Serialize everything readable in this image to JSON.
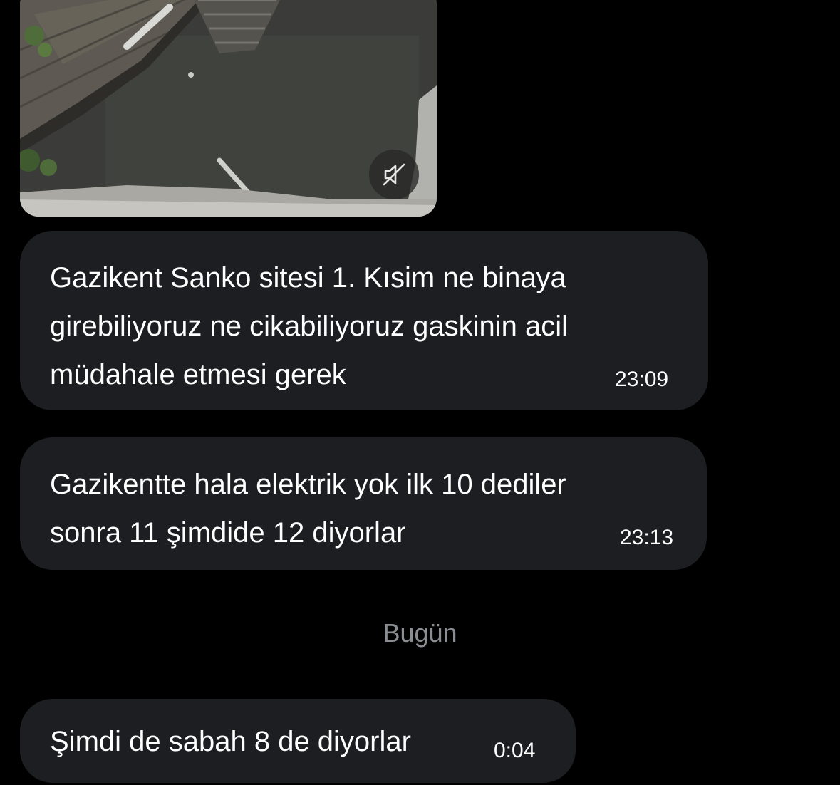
{
  "conversation": {
    "video_message": {
      "mute_icon": "speaker-muted-icon"
    },
    "messages": [
      {
        "lines": [
          "Gazikent Sanko sitesi 1. Kısim ne binaya",
          "girebiliyoruz ne cikabiliyoruz gaskinin acil",
          "müdahale etmesi gerek"
        ],
        "time": "23:09"
      },
      {
        "lines": [
          "Gazikentte hala elektrik yok ilk 10 dediler",
          "sonra 11 şimdide 12 diyorlar"
        ],
        "time": "23:13"
      }
    ],
    "day_divider": "Bugün",
    "latest_message": {
      "text": "Şimdi de sabah 8 de diyorlar",
      "time": "0:04"
    }
  },
  "colors": {
    "background": "#000000",
    "bubble": "#1d1e21",
    "divider_text": "#8a8d92"
  }
}
